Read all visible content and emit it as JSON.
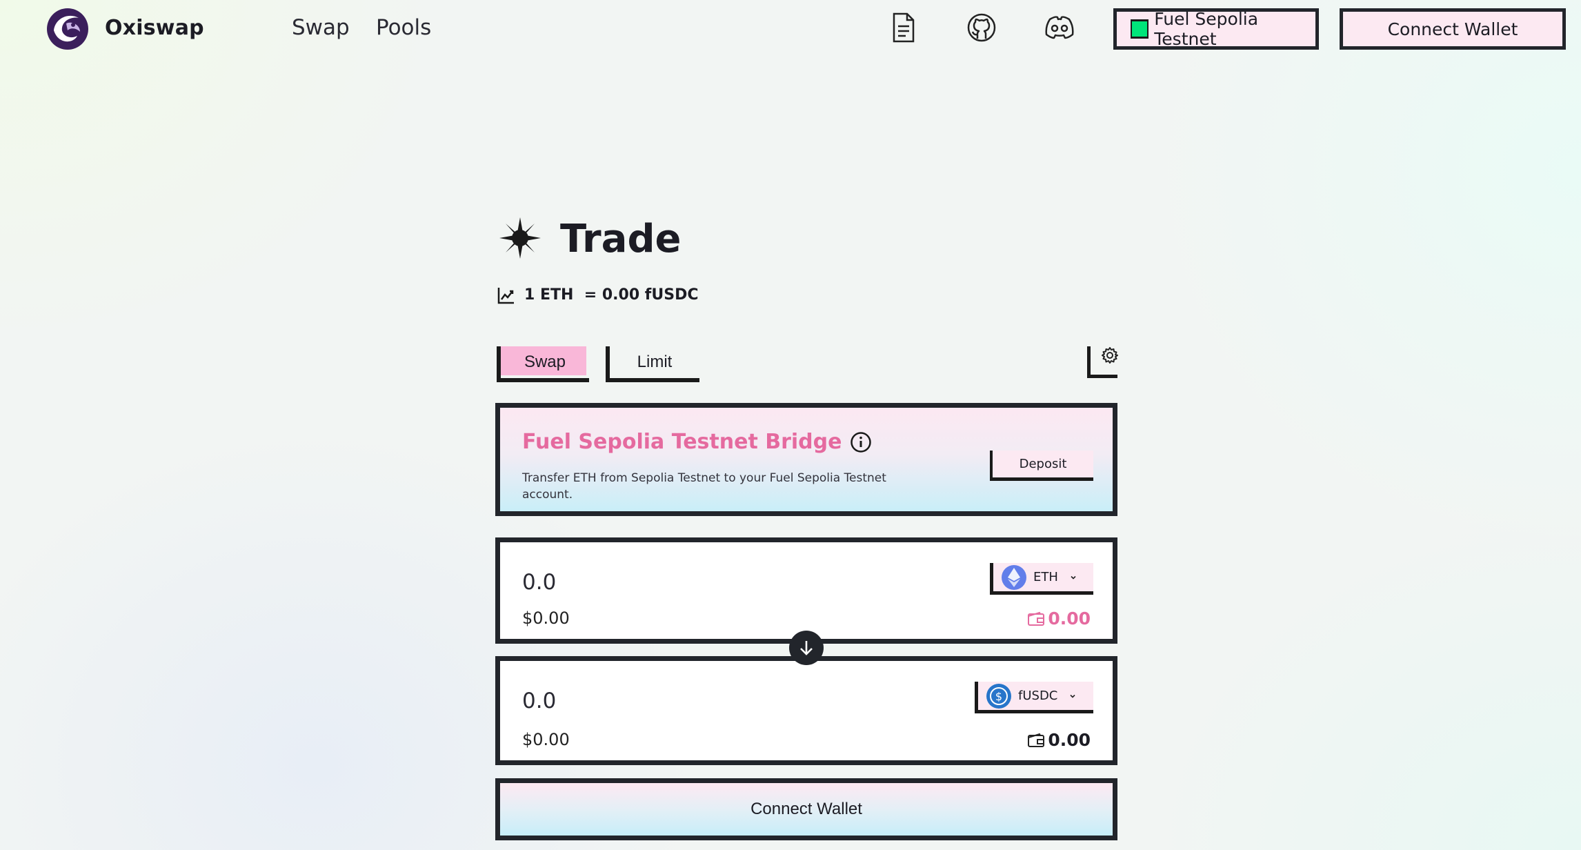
{
  "header": {
    "brand": "Oxiswap",
    "nav": [
      {
        "label": "Swap"
      },
      {
        "label": "Pools"
      }
    ],
    "icons": [
      "document-icon",
      "github-icon",
      "discord-icon"
    ],
    "network_label": "Fuel Sepolia Testnet",
    "connect_label": "Connect Wallet"
  },
  "trade": {
    "title": "Trade",
    "rate_base": "1 ETH",
    "rate_value": "= 0.00 fUSDC"
  },
  "tabs": {
    "swap": "Swap",
    "limit": "Limit"
  },
  "bridge": {
    "title": "Fuel Sepolia Testnet Bridge",
    "description": "Transfer ETH from Sepolia Testnet to your Fuel Sepolia Testnet account.",
    "deposit_label": "Deposit"
  },
  "from": {
    "amount": "0.0",
    "usd": "$0.00",
    "token": "ETH",
    "balance": "0.00"
  },
  "to": {
    "amount": "0.0",
    "usd": "$0.00",
    "token": "fUSDC",
    "balance": "0.00"
  },
  "main_button": "Connect Wallet",
  "colors": {
    "accent_pink": "#e56a9f",
    "tab_active": "#f9b7d8",
    "border_dark": "#22252b",
    "button_pink": "#fce9f2",
    "network_green": "#00e57a",
    "eth_blue": "#627eea",
    "usdc_blue": "#2775ca"
  }
}
